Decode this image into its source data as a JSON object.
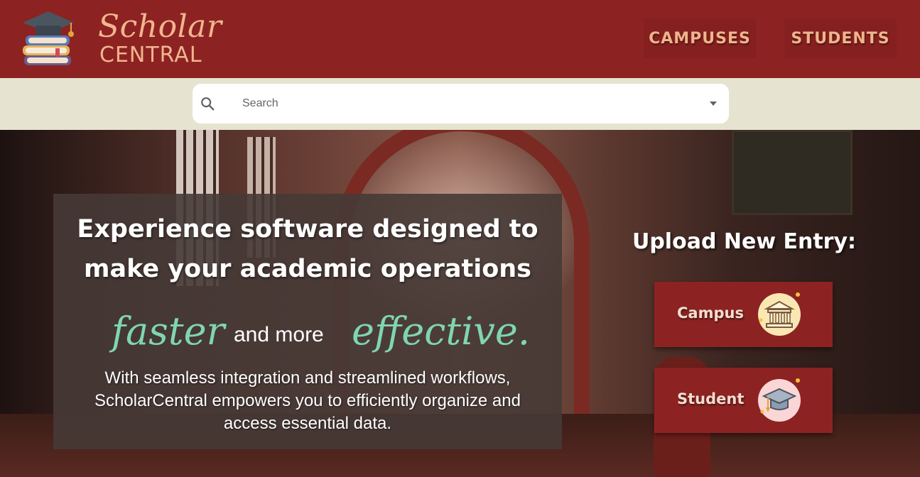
{
  "header": {
    "brand_script": "Scholar",
    "brand_main": "CENTRAL",
    "logo_icon": "books-graduation-cap-icon",
    "nav": [
      {
        "label": "CAMPUSES"
      },
      {
        "label": "STUDENTS"
      }
    ]
  },
  "search": {
    "placeholder": "Search",
    "value": "",
    "icon": "search-icon",
    "dropdown_icon": "chevron-down-icon"
  },
  "hero": {
    "heading_line1": "Experience software designed to",
    "heading_line2": "make your academic operations",
    "word_faster": "faster",
    "word_andmore": "and more",
    "word_effective": "effective.",
    "body": "With seamless integration and streamlined workflows, ScholarCentral empowers you to efficiently organize and access essential data."
  },
  "upload": {
    "title": "Upload New Entry:",
    "buttons": [
      {
        "label": "Campus",
        "icon": "campus-building-icon"
      },
      {
        "label": "Student",
        "icon": "student-cap-icon"
      }
    ]
  },
  "colors": {
    "header_bg": "#8c2322",
    "brand_text": "#f2b58f",
    "search_band": "#e6e3d0",
    "accent_green": "#7fd6b0",
    "button_bg": "#8c2322"
  }
}
